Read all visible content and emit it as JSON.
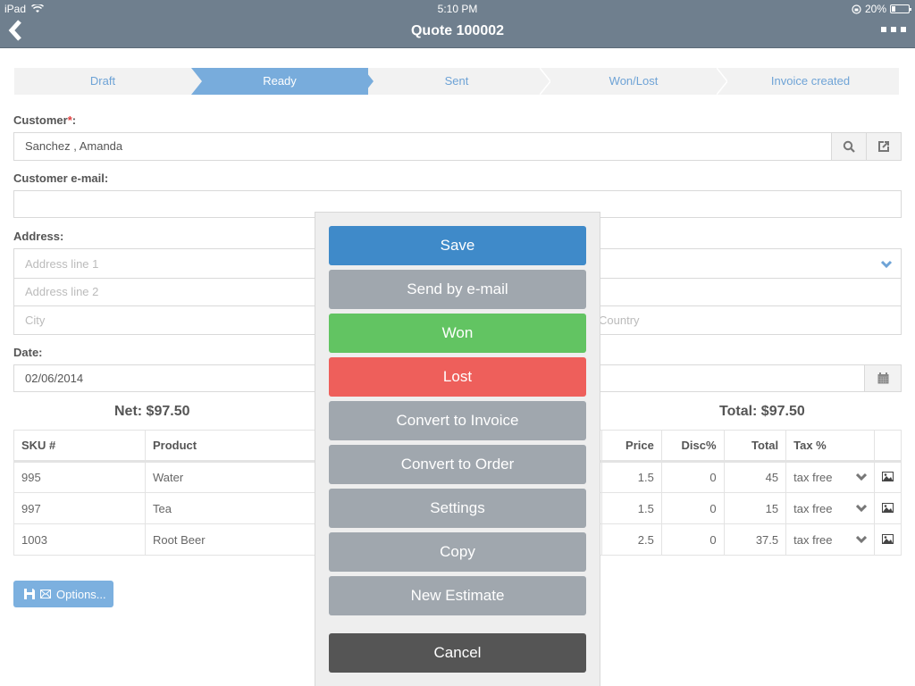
{
  "status_bar": {
    "device": "iPad",
    "time": "5:10 PM",
    "battery": "20%"
  },
  "nav": {
    "title": "Quote 100002",
    "back_icon": "chevron-left-icon",
    "more_icon": "more-dots-icon"
  },
  "stepper": [
    {
      "label": "Draft",
      "active": false
    },
    {
      "label": "Ready",
      "active": true
    },
    {
      "label": "Sent",
      "active": false
    },
    {
      "label": "Won/Lost",
      "active": false
    },
    {
      "label": "Invoice created",
      "active": false
    }
  ],
  "form": {
    "customer_label": "Customer",
    "required_mark": "*",
    "colon": ":",
    "customer_value": "Sanchez , Amanda",
    "email_label": "Customer e-mail:",
    "email_value": "",
    "address_label": "Address:",
    "address_line1_placeholder": "Address line 1",
    "address_line2_placeholder": "Address line 2",
    "city_placeholder": "City",
    "country_placeholder": "Country",
    "date_label": "Date:",
    "date_value": "02/06/2014"
  },
  "summary": {
    "net": "Net: $97.50",
    "total": "Total: $97.50"
  },
  "table": {
    "headers": {
      "sku": "SKU #",
      "product": "Product",
      "price": "Price",
      "disc": "Disc%",
      "total": "Total",
      "tax": "Tax %"
    },
    "rows": [
      {
        "sku": "995",
        "product": "Water",
        "price": "1.5",
        "disc": "0",
        "total": "45",
        "tax": "tax free"
      },
      {
        "sku": "997",
        "product": "Tea",
        "price": "1.5",
        "disc": "0",
        "total": "15",
        "tax": "tax free"
      },
      {
        "sku": "1003",
        "product": "Root Beer",
        "price": "2.5",
        "disc": "0",
        "total": "37.5",
        "tax": "tax free"
      }
    ]
  },
  "options_button": "Options...",
  "action_sheet": {
    "buttons": [
      {
        "label": "Save",
        "color": "#3f8ac9"
      },
      {
        "label": "Send by e-mail",
        "color": "#a0a7ae"
      },
      {
        "label": "Won",
        "color": "#62c462"
      },
      {
        "label": "Lost",
        "color": "#ee5f5b"
      },
      {
        "label": "Convert to Invoice",
        "color": "#a0a7ae"
      },
      {
        "label": "Convert to Order",
        "color": "#a0a7ae"
      },
      {
        "label": "Settings",
        "color": "#a0a7ae"
      },
      {
        "label": "Copy",
        "color": "#a0a7ae"
      },
      {
        "label": "New Estimate",
        "color": "#a0a7ae"
      }
    ],
    "cancel": {
      "label": "Cancel",
      "color": "#555555"
    }
  },
  "colors": {
    "navbar": "#6f7f8e",
    "accent": "#78acdc"
  }
}
